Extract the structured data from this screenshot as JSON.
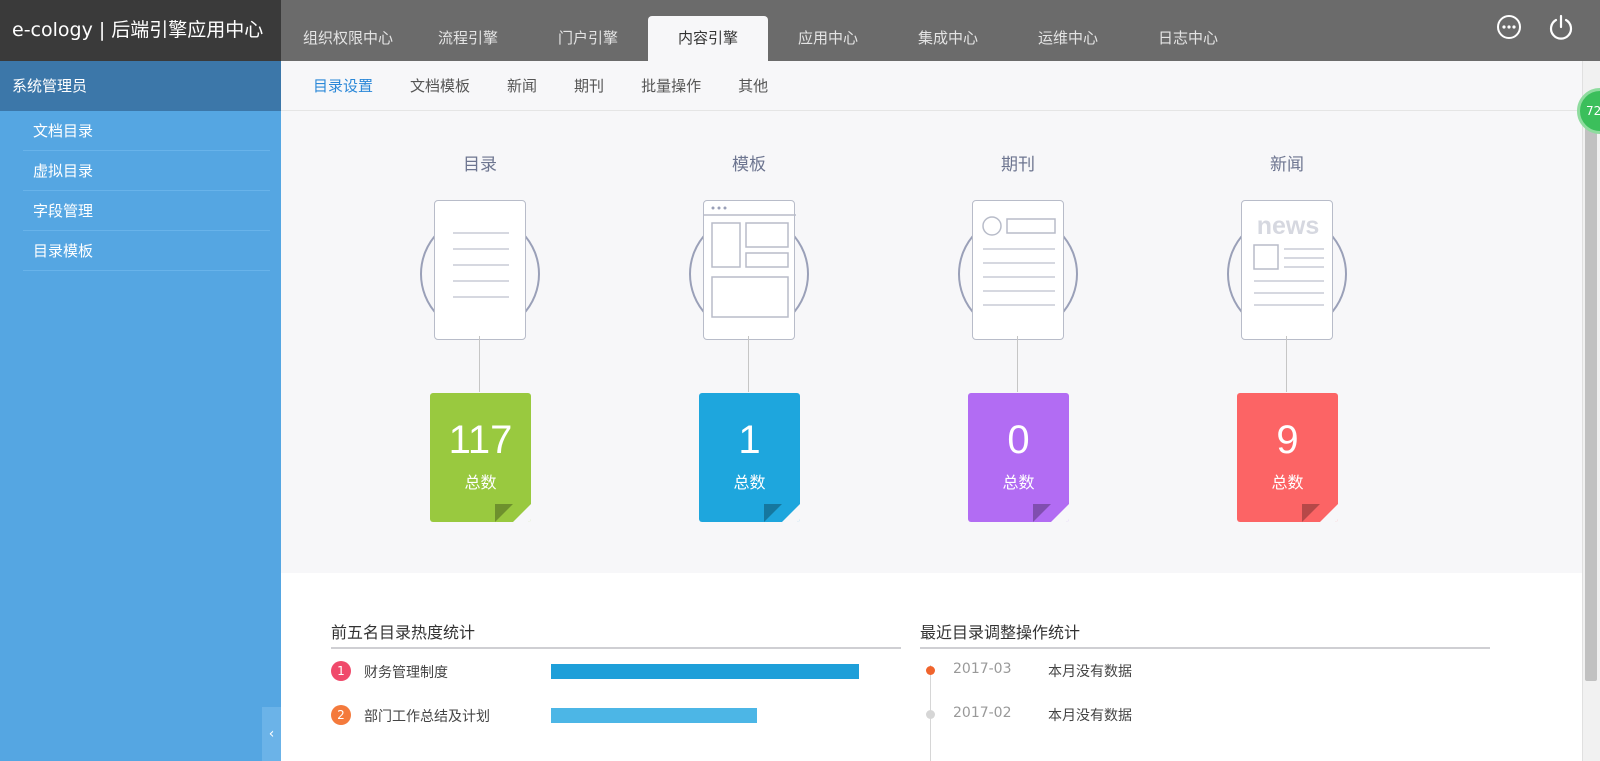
{
  "header": {
    "brand": "e-cology | 后端引擎应用中心",
    "tabs": [
      {
        "label": "组织权限中心"
      },
      {
        "label": "流程引擎"
      },
      {
        "label": "门户引擎"
      },
      {
        "label": "内容引擎"
      },
      {
        "label": "应用中心"
      },
      {
        "label": "集成中心"
      },
      {
        "label": "运维中心"
      },
      {
        "label": "日志中心"
      }
    ],
    "active_tab": "内容引擎",
    "icons": [
      "more-icon",
      "power-icon"
    ]
  },
  "sidebar": {
    "heading": "系统管理员",
    "items": [
      {
        "label": "文档目录"
      },
      {
        "label": "虚拟目录"
      },
      {
        "label": "字段管理"
      },
      {
        "label": "目录模板"
      }
    ],
    "collapse_glyph": "‹"
  },
  "subnav": {
    "tabs": [
      {
        "label": "目录设置"
      },
      {
        "label": "文档模板"
      },
      {
        "label": "新闻"
      },
      {
        "label": "期刊"
      },
      {
        "label": "批量操作"
      },
      {
        "label": "其他"
      }
    ],
    "active_tab": "目录设置"
  },
  "stats": [
    {
      "title": "目录",
      "count": "117",
      "label": "总数",
      "color": "#99c93f",
      "icon": "document-icon"
    },
    {
      "title": "模板",
      "count": "1",
      "label": "总数",
      "color": "#1ea6dd",
      "icon": "template-icon"
    },
    {
      "title": "期刊",
      "count": "0",
      "label": "总数",
      "color": "#b26cf3",
      "icon": "journal-icon"
    },
    {
      "title": "新闻",
      "count": "9",
      "label": "总数",
      "color": "#fc6465",
      "icon": "newspaper-icon"
    }
  ],
  "news_icon_text": "news",
  "hot_ranking": {
    "title": "前五名目录热度统计",
    "items": [
      {
        "rank": "1",
        "name": "财务管理制度",
        "share": 1.0,
        "bar_color": "#1e9fd9",
        "badge_color": "#f04a6b"
      },
      {
        "rank": "2",
        "name": "部门工作总结及计划",
        "share": 0.67,
        "bar_color": "#4cb6e6",
        "badge_color": "#f47a3c"
      }
    ]
  },
  "recent_ops": {
    "title": "最近目录调整操作统计",
    "items": [
      {
        "date": "2017-03",
        "text": "本月没有数据",
        "dot_color": "#f0642d"
      },
      {
        "date": "2017-02",
        "text": "本月没有数据",
        "dot_color": "#d6d6d6"
      }
    ]
  },
  "float_badge": "72"
}
